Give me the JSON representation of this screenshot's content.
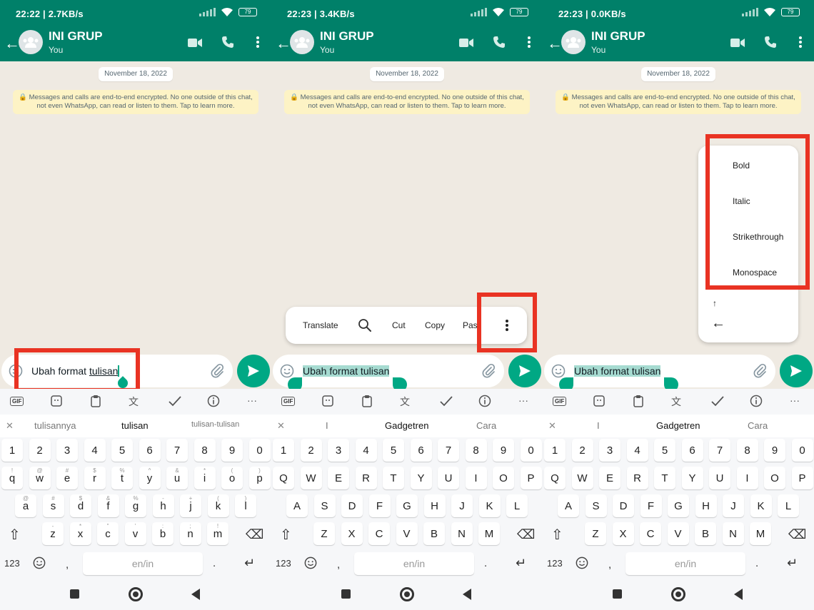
{
  "panels": [
    {
      "status": {
        "time": "22:22 | 2.7KB/s",
        "battery": "79"
      },
      "header": {
        "title": "INI GRUP",
        "subtitle": "You"
      },
      "chat": {
        "date": "November 18, 2022",
        "encryption": "Messages and calls are end-to-end encrypted. No one outside of this chat, not even WhatsApp, can read or listen to them. Tap to learn more."
      },
      "input": {
        "text_plain": "Ubah format ",
        "text_underlined": "tulisan"
      },
      "suggestions": [
        "tulisannya",
        "tulisan",
        "tulisan-tulisan"
      ],
      "keyboard": {
        "shift_case": "lower"
      }
    },
    {
      "status": {
        "time": "22:23 | 3.4KB/s",
        "battery": "79"
      },
      "header": {
        "title": "INI GRUP",
        "subtitle": "You"
      },
      "chat": {
        "date": "November 18, 2022",
        "encryption": "Messages and calls are end-to-end encrypted. No one outside of this chat, not even WhatsApp, can read or listen to them. Tap to learn more."
      },
      "input": {
        "text_selected": "Ubah format tulisan"
      },
      "selection_toolbar": {
        "translate": "Translate",
        "cut": "Cut",
        "copy": "Copy",
        "paste": "Pas"
      },
      "suggestions": [
        "I",
        "Gadgetren",
        "Cara"
      ],
      "keyboard": {
        "shift_case": "upper"
      }
    },
    {
      "status": {
        "time": "22:23 | 0.0KB/s",
        "battery": "79"
      },
      "header": {
        "title": "INI GRUP",
        "subtitle": "You"
      },
      "chat": {
        "date": "November 18, 2022",
        "encryption": "Messages and calls are end-to-end encrypted. No one outside of this chat, not even WhatsApp, can read or listen to them. Tap to learn more."
      },
      "input": {
        "text_selected": "Ubah format tulisan"
      },
      "format_menu": {
        "bold": "Bold",
        "italic": "Italic",
        "strikethrough": "Strikethrough",
        "monospace": "Monospace"
      },
      "suggestions": [
        "I",
        "Gadgetren",
        "Cara"
      ],
      "keyboard": {
        "shift_case": "upper"
      }
    }
  ],
  "keyboard": {
    "numbers": [
      "1",
      "2",
      "3",
      "4",
      "5",
      "6",
      "7",
      "8",
      "9",
      "0"
    ],
    "row1": [
      "q",
      "w",
      "e",
      "r",
      "t",
      "y",
      "u",
      "i",
      "o",
      "p"
    ],
    "row2": [
      "a",
      "s",
      "d",
      "f",
      "g",
      "h",
      "j",
      "k",
      "l"
    ],
    "row3": [
      "z",
      "x",
      "c",
      "v",
      "b",
      "n",
      "m"
    ],
    "alt1": [
      "!",
      "@",
      "#",
      "$",
      "%",
      "^",
      "&",
      "*",
      "(",
      ")"
    ],
    "alt2": [
      "@",
      "#",
      "$",
      "&",
      "%",
      "-",
      "+",
      "(",
      ")"
    ],
    "alt3": [
      "-",
      "*",
      "\"",
      "'",
      ":",
      ";",
      "!"
    ],
    "num_label": "123",
    "comma": ",",
    "period": ".",
    "space_label": "en/in",
    "gif_label": "GIF"
  },
  "colors": {
    "header": "#008069",
    "accent": "#00a884",
    "highlight": "#e93323"
  }
}
